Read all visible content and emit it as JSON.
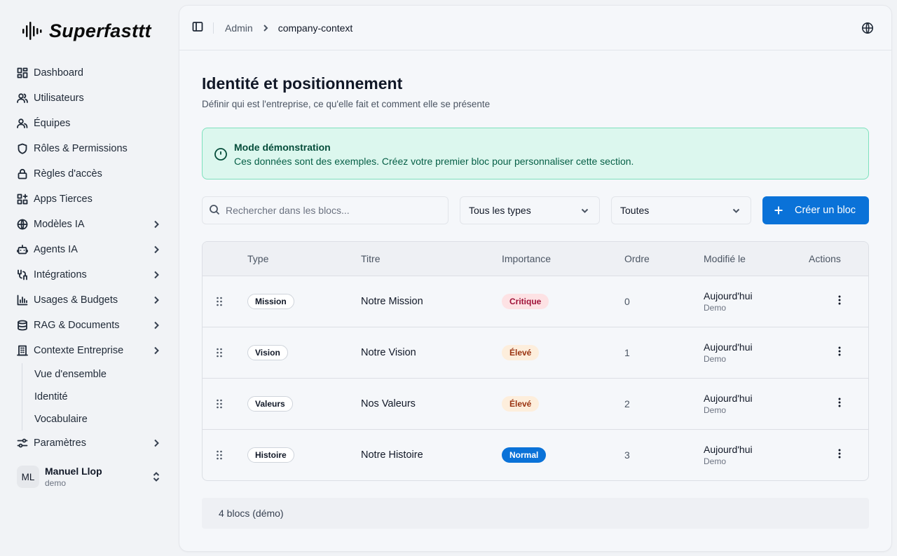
{
  "app": {
    "name": "Superfasttt"
  },
  "sidebar": {
    "items": [
      {
        "label": "Dashboard",
        "icon": "dashboard-icon"
      },
      {
        "label": "Utilisateurs",
        "icon": "users-icon"
      },
      {
        "label": "Équipes",
        "icon": "team-icon"
      },
      {
        "label": "Rôles & Permissions",
        "icon": "shield-icon"
      },
      {
        "label": "Règles d'accès",
        "icon": "lock-icon"
      },
      {
        "label": "Apps Tierces",
        "icon": "apps-icon"
      },
      {
        "label": "Modèles IA",
        "icon": "globe-icon",
        "expandable": true
      },
      {
        "label": "Agents IA",
        "icon": "agent-icon",
        "expandable": true
      },
      {
        "label": "Intégrations",
        "icon": "integrations-icon",
        "expandable": true
      },
      {
        "label": "Usages & Budgets",
        "icon": "chart-icon",
        "expandable": true
      },
      {
        "label": "RAG & Documents",
        "icon": "database-icon",
        "expandable": true
      },
      {
        "label": "Contexte Entreprise",
        "icon": "building-icon",
        "expandable": true
      },
      {
        "label": "Paramètres",
        "icon": "settings-icon",
        "expandable": true
      }
    ],
    "subitems": [
      {
        "label": "Vue d'ensemble"
      },
      {
        "label": "Identité"
      },
      {
        "label": "Vocabulaire"
      }
    ],
    "user": {
      "initials": "ML",
      "name": "Manuel Llop",
      "role": "demo"
    }
  },
  "header": {
    "breadcrumb_parent": "Admin",
    "breadcrumb_current": "company-context"
  },
  "page": {
    "title": "Identité et positionnement",
    "subtitle": "Définir qui est l'entreprise, ce qu'elle fait et comment elle se présente"
  },
  "alert": {
    "title": "Mode démonstration",
    "text": "Ces données sont des exemples. Créez votre premier bloc pour personnaliser cette section."
  },
  "toolbar": {
    "search_placeholder": "Rechercher dans les blocs...",
    "type_filter": "Tous les types",
    "importance_filter": "Toutes",
    "create_label": "Créer un bloc"
  },
  "table": {
    "headers": {
      "type": "Type",
      "title": "Titre",
      "importance": "Importance",
      "order": "Ordre",
      "modified": "Modifié le",
      "actions": "Actions"
    },
    "rows": [
      {
        "type": "Mission",
        "title": "Notre Mission",
        "importance": "Critique",
        "importance_level": "critique",
        "order": "0",
        "modified": "Aujourd'hui",
        "modified_by": "Demo"
      },
      {
        "type": "Vision",
        "title": "Notre Vision",
        "importance": "Élevé",
        "importance_level": "eleve",
        "order": "1",
        "modified": "Aujourd'hui",
        "modified_by": "Demo"
      },
      {
        "type": "Valeurs",
        "title": "Nos Valeurs",
        "importance": "Élevé",
        "importance_level": "eleve",
        "order": "2",
        "modified": "Aujourd'hui",
        "modified_by": "Demo"
      },
      {
        "type": "Histoire",
        "title": "Notre Histoire",
        "importance": "Normal",
        "importance_level": "normal",
        "order": "3",
        "modified": "Aujourd'hui",
        "modified_by": "Demo"
      }
    ]
  },
  "footer": {
    "count_label": "4 blocs (démo)"
  },
  "colors": {
    "accent": "#0a72d8",
    "alert_bg": "#dcf7ee",
    "alert_border": "#7ee1bd",
    "critique": "#fde2e4",
    "eleve": "#fdeedc"
  }
}
